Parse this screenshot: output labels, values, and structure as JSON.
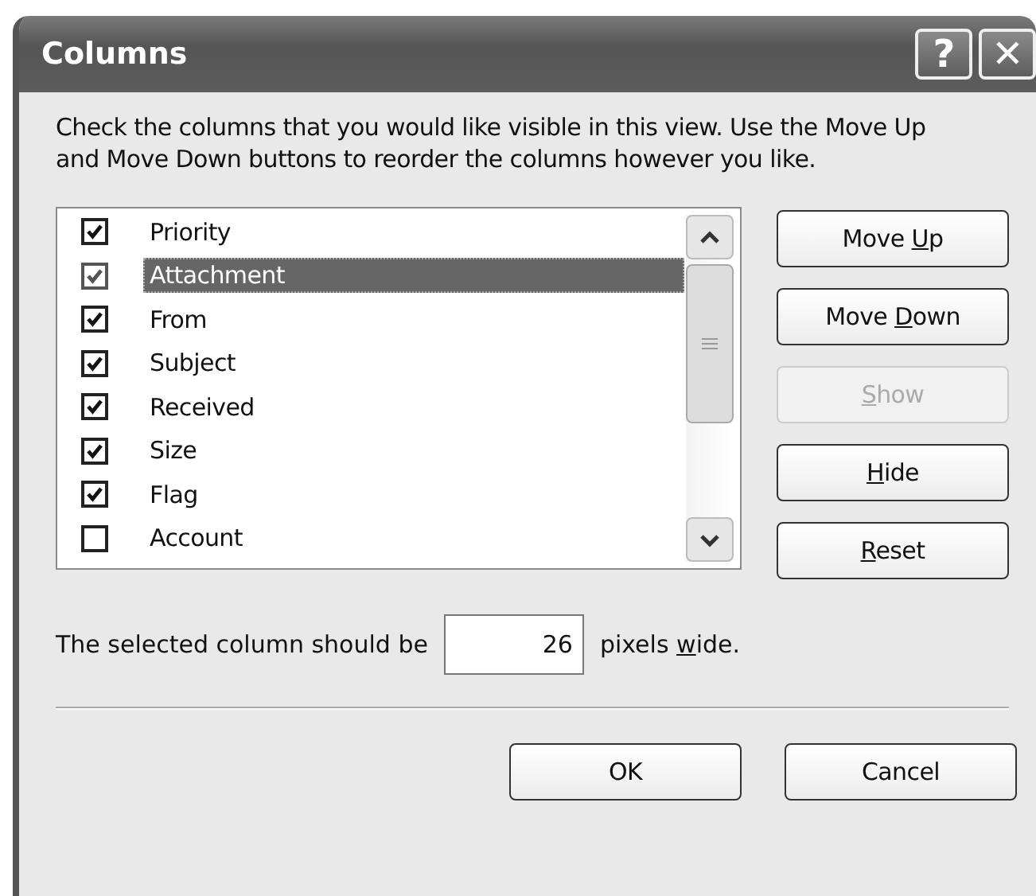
{
  "window": {
    "title": "Columns",
    "help_button": "?",
    "close_button": "✕"
  },
  "instructions": "Check the columns that you would like visible in this view.  Use the Move Up and Move Down buttons to reorder the columns however you like.",
  "columns": [
    {
      "label": "Priority",
      "checked": true,
      "selected": false
    },
    {
      "label": "Attachment",
      "checked": true,
      "selected": true
    },
    {
      "label": "From",
      "checked": true,
      "selected": false
    },
    {
      "label": "Subject",
      "checked": true,
      "selected": false
    },
    {
      "label": "Received",
      "checked": true,
      "selected": false
    },
    {
      "label": "Size",
      "checked": true,
      "selected": false
    },
    {
      "label": "Flag",
      "checked": true,
      "selected": false
    },
    {
      "label": "Account",
      "checked": false,
      "selected": false
    }
  ],
  "side_buttons": [
    {
      "before": "Move ",
      "key": "U",
      "after": "p",
      "disabled": false
    },
    {
      "before": "Move ",
      "key": "D",
      "after": "own",
      "disabled": false
    },
    {
      "key": "S",
      "after": "how",
      "disabled": true
    },
    {
      "key": "H",
      "after": "ide",
      "disabled": false
    },
    {
      "key": "R",
      "after": "eset",
      "disabled": false
    }
  ],
  "width_row": {
    "before": "The selected column should be",
    "value": "26",
    "after": {
      "before": "pixels ",
      "key": "w",
      "after": "ide."
    }
  },
  "footer_buttons": [
    "OK",
    "Cancel"
  ]
}
